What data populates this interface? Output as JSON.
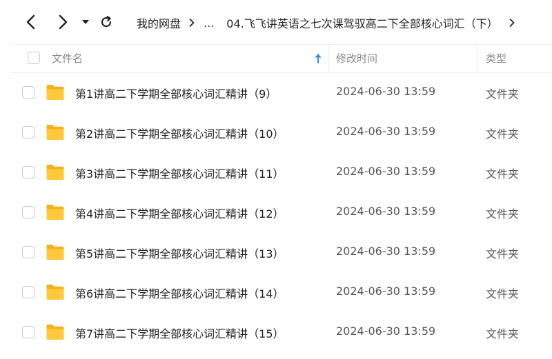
{
  "breadcrumb": {
    "root": "我的网盘",
    "ellipsis": "...",
    "current": "04.飞飞讲英语之七次课驾驭高二下全部核心词汇（下）"
  },
  "columns": {
    "name": "文件名",
    "modified": "修改时间",
    "type": "类型"
  },
  "files": [
    {
      "name": "第1讲高二下学期全部核心词汇精讲（9）",
      "modified": "2024-06-30 13:59",
      "type": "文件夹"
    },
    {
      "name": "第2讲高二下学期全部核心词汇精讲（10）",
      "modified": "2024-06-30 13:59",
      "type": "文件夹"
    },
    {
      "name": "第3讲高二下学期全部核心词汇精讲（11）",
      "modified": "2024-06-30 13:59",
      "type": "文件夹"
    },
    {
      "name": "第4讲高二下学期全部核心词汇精讲（12）",
      "modified": "2024-06-30 13:59",
      "type": "文件夹"
    },
    {
      "name": "第5讲高二下学期全部核心词汇精讲（13）",
      "modified": "2024-06-30 13:59",
      "type": "文件夹"
    },
    {
      "name": "第6讲高二下学期全部核心词汇精讲（14）",
      "modified": "2024-06-30 13:59",
      "type": "文件夹"
    },
    {
      "name": "第7讲高二下学期全部核心词汇精讲（15）",
      "modified": "2024-06-30 13:59",
      "type": "文件夹"
    }
  ],
  "icons": {
    "back": "chevron-left-icon",
    "forward": "chevron-right-icon",
    "history": "caret-down-icon",
    "refresh": "refresh-icon",
    "separator": "chevron-right-icon",
    "sort": "arrow-up-icon",
    "folder": "folder-icon"
  },
  "colors": {
    "folder": "#ffc93c",
    "folder_dark": "#f5b21f",
    "sort_arrow": "#2b8cf0"
  }
}
